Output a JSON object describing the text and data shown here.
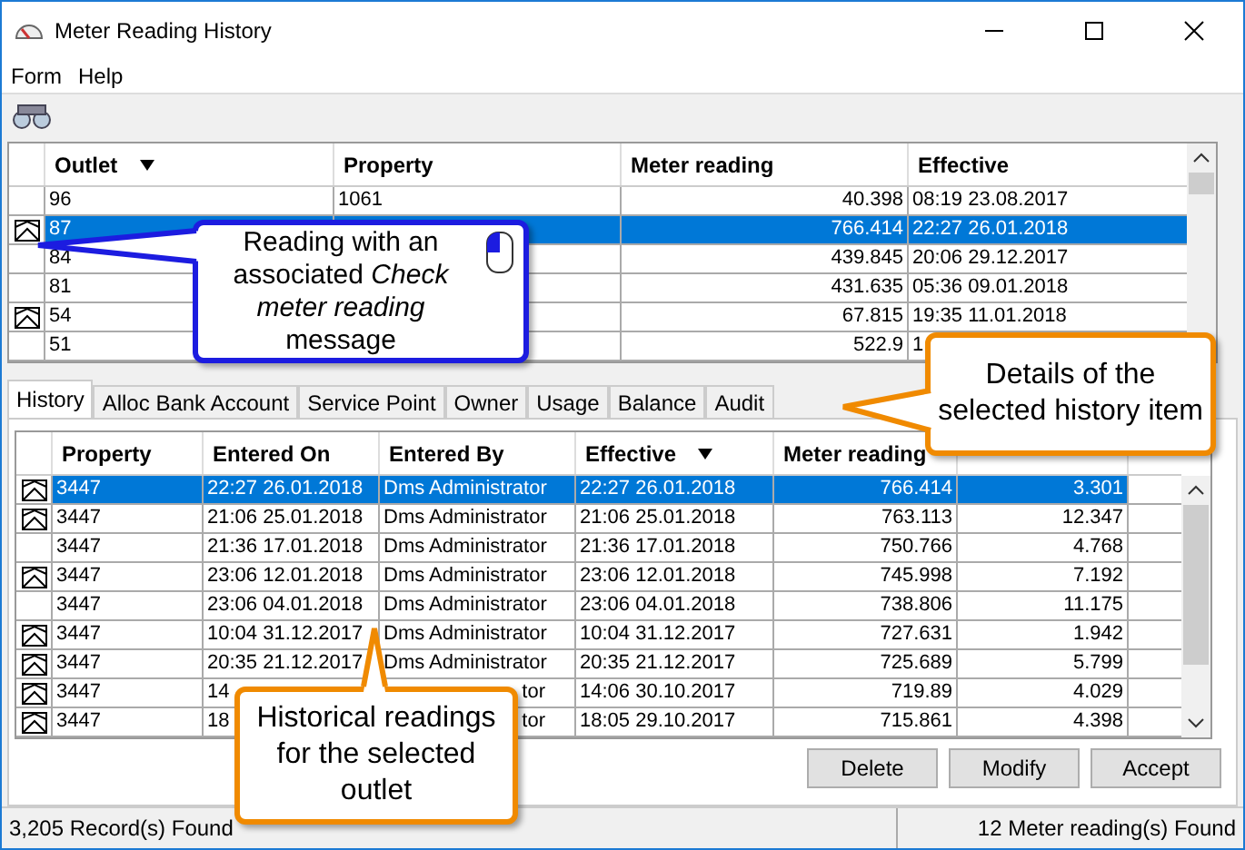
{
  "window": {
    "title": "Meter Reading History"
  },
  "menu": [
    "Form",
    "Help"
  ],
  "outlets": {
    "columns": [
      {
        "label": "Outlet",
        "sorted": true
      },
      {
        "label": "Property",
        "sorted": false
      },
      {
        "label": "Meter reading",
        "sorted": false
      },
      {
        "label": "Effective",
        "sorted": false
      }
    ],
    "rows": [
      {
        "message": false,
        "selected": false,
        "outlet": "96",
        "property": "1061",
        "reading": "40.398",
        "effective": "08:19 23.08.2017"
      },
      {
        "message": true,
        "selected": true,
        "outlet": "87",
        "reading": "766.414",
        "effective": "22:27 26.01.2018"
      },
      {
        "message": false,
        "selected": false,
        "outlet": "84",
        "reading": "439.845",
        "effective": "20:06 29.12.2017"
      },
      {
        "message": false,
        "selected": false,
        "outlet": "81",
        "reading": "431.635",
        "effective": "05:36 09.01.2018"
      },
      {
        "message": true,
        "selected": false,
        "outlet": "54",
        "reading": "67.815",
        "effective": "19:35 11.01.2018"
      },
      {
        "message": false,
        "selected": false,
        "outlet": "51",
        "reading": "522.9",
        "effective": "1"
      }
    ]
  },
  "tabs": [
    {
      "label": "History",
      "selected": true
    },
    {
      "label": "Alloc Bank Account",
      "selected": false
    },
    {
      "label": "Service Point",
      "selected": false
    },
    {
      "label": "Owner",
      "selected": false
    },
    {
      "label": "Usage",
      "selected": false
    },
    {
      "label": "Balance",
      "selected": false
    },
    {
      "label": "Audit",
      "selected": false
    }
  ],
  "history": {
    "columns": [
      {
        "label": "Property",
        "sorted": false
      },
      {
        "label": "Entered On",
        "sorted": false
      },
      {
        "label": "Entered By",
        "sorted": false
      },
      {
        "label": "Effective",
        "sorted": true
      },
      {
        "label": "Meter reading",
        "sorted": false
      },
      {
        "sorted": false
      }
    ],
    "rows": [
      {
        "message": true,
        "selected": true,
        "property": "3447",
        "entered_on": "22:27 26.01.2018",
        "entered_by": "Dms Administrator",
        "effective": "22:27 26.01.2018",
        "reading": "766.414",
        "column_6": "3.301"
      },
      {
        "message": true,
        "selected": false,
        "property": "3447",
        "entered_on": "21:06 25.01.2018",
        "entered_by": "Dms Administrator",
        "effective": "21:06 25.01.2018",
        "reading": "763.113",
        "column_6": "12.347"
      },
      {
        "message": false,
        "selected": false,
        "property": "3447",
        "entered_on": "21:36 17.01.2018",
        "entered_by": "Dms Administrator",
        "effective": "21:36 17.01.2018",
        "reading": "750.766",
        "column_6": "4.768"
      },
      {
        "message": true,
        "selected": false,
        "property": "3447",
        "entered_on": "23:06 12.01.2018",
        "entered_by": "Dms Administrator",
        "effective": "23:06 12.01.2018",
        "reading": "745.998",
        "column_6": "7.192"
      },
      {
        "message": false,
        "selected": false,
        "property": "3447",
        "entered_on": "23:06 04.01.2018",
        "entered_by": "Dms Administrator",
        "effective": "23:06 04.01.2018",
        "reading": "738.806",
        "column_6": "11.175"
      },
      {
        "message": true,
        "selected": false,
        "property": "3447",
        "entered_on": "10:04 31.12.2017",
        "entered_by": "Dms Administrator",
        "effective": "10:04 31.12.2017",
        "reading": "727.631",
        "column_6": "1.942"
      },
      {
        "message": true,
        "selected": false,
        "property": "3447",
        "entered_on": "20:35 21.12.2017",
        "entered_by": "Dms Administrator",
        "effective": "20:35 21.12.2017",
        "reading": "725.689",
        "column_6": "5.799"
      },
      {
        "message": true,
        "selected": false,
        "property": "3447",
        "entered_on": "14",
        "entered_by": "tor",
        "entered_by_cut": true,
        "effective": "14:06 30.10.2017",
        "reading": "719.89",
        "column_6": "4.029"
      },
      {
        "message": true,
        "selected": false,
        "property": "3447",
        "entered_on": "18",
        "entered_by": "tor",
        "entered_by_cut": true,
        "effective": "18:05 29.10.2017",
        "reading": "715.861",
        "column_6": "4.398"
      }
    ]
  },
  "buttons": [
    "Delete",
    "Modify",
    "Accept"
  ],
  "status_bar": [
    "3,205 Record(s) Found",
    "12 Meter reading(s) Found"
  ],
  "callouts": [
    {
      "kind": "blue",
      "text": "Reading with an associated *Check meter reading* message"
    },
    {
      "kind": "orange-right",
      "text": "Details of the selected history item"
    },
    {
      "kind": "orange-up",
      "text": "Historical readings for the selected outlet"
    }
  ]
}
